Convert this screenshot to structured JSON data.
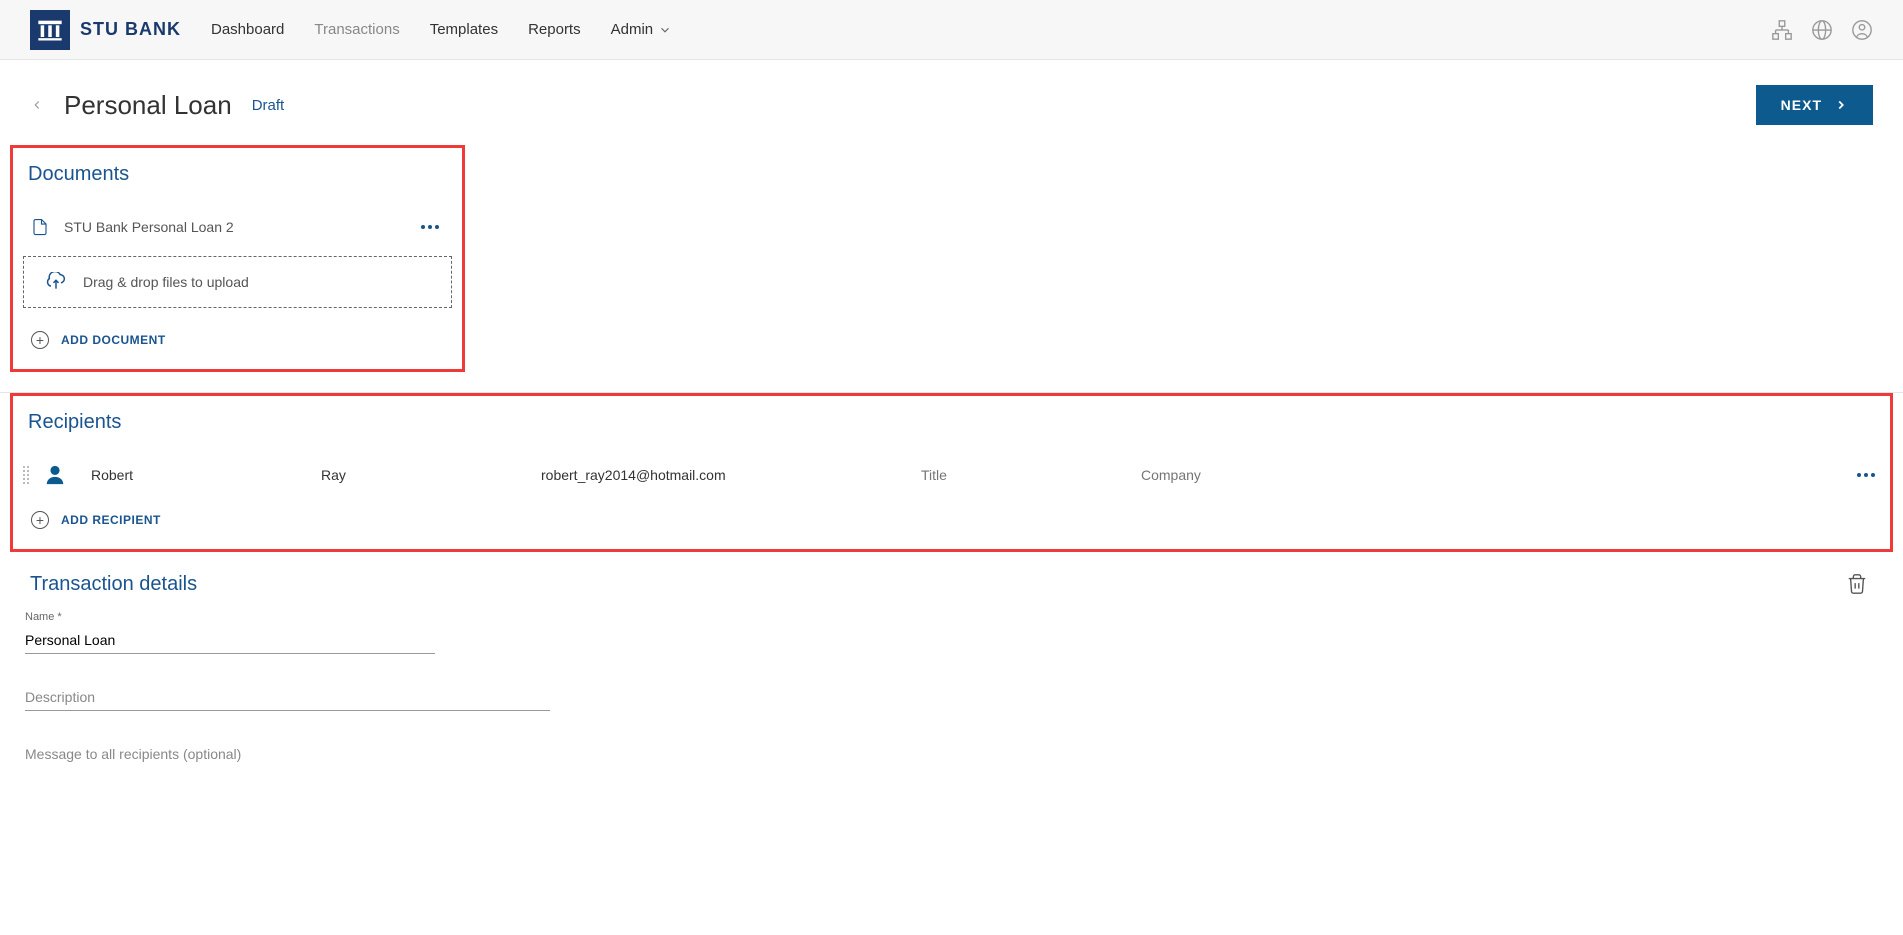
{
  "brand": {
    "name": "STU BANK"
  },
  "nav": {
    "items": [
      {
        "label": "Dashboard",
        "active": false
      },
      {
        "label": "Transactions",
        "active": true
      },
      {
        "label": "Templates",
        "active": false
      },
      {
        "label": "Reports",
        "active": false
      },
      {
        "label": "Admin",
        "active": false,
        "dropdown": true
      }
    ]
  },
  "page": {
    "title": "Personal Loan",
    "status": "Draft",
    "next_label": "NEXT"
  },
  "documents": {
    "title": "Documents",
    "items": [
      {
        "name": "STU Bank Personal Loan 2"
      }
    ],
    "dropzone_text": "Drag & drop files to upload",
    "add_label": "ADD DOCUMENT"
  },
  "recipients": {
    "title": "Recipients",
    "items": [
      {
        "first_name": "Robert",
        "last_name": "Ray",
        "email": "robert_ray2014@hotmail.com",
        "title": "",
        "company": "",
        "title_placeholder": "Title",
        "company_placeholder": "Company"
      }
    ],
    "add_label": "ADD RECIPIENT"
  },
  "details": {
    "title": "Transaction details",
    "name_label": "Name *",
    "name_value": "Personal Loan",
    "description_label": "Description",
    "description_value": "",
    "message_label": "Message to all recipients (optional)",
    "message_value": ""
  }
}
